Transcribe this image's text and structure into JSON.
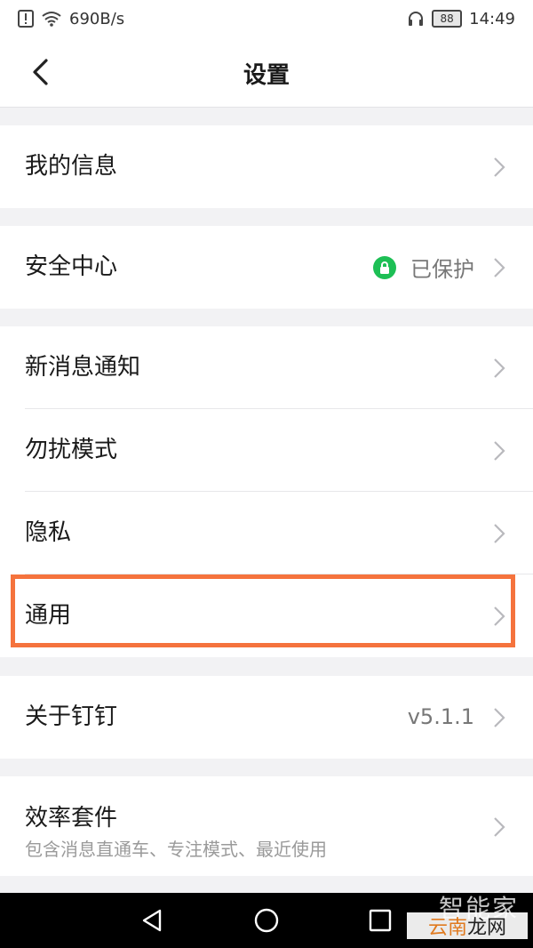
{
  "status_bar": {
    "speed": "690B/s",
    "battery": "88",
    "time": "14:49"
  },
  "header": {
    "title": "设置"
  },
  "rows": {
    "my_info": "我的信息",
    "security": {
      "label": "安全中心",
      "status": "已保护"
    },
    "notifications": "新消息通知",
    "dnd": "勿扰模式",
    "privacy": "隐私",
    "general": "通用",
    "about": {
      "label": "关于钉钉",
      "version": "v5.1.1"
    },
    "efficiency": {
      "label": "效率套件",
      "subtitle": "包含消息直通车、专注模式、最近使用"
    }
  },
  "watermark": {
    "top": "智能家",
    "bottom_a": "云南",
    "bottom_b": "龙网"
  },
  "colors": {
    "highlight": "#f5733d",
    "security_green": "#1dbf55",
    "background": "#f2f2f4"
  },
  "icons": {
    "back": "chevron-left-icon",
    "row_arrow": "chevron-right-icon",
    "security_status": "lock-icon",
    "nav_back": "triangle-back-icon",
    "nav_home": "circle-home-icon",
    "nav_recent": "square-recent-icon"
  }
}
